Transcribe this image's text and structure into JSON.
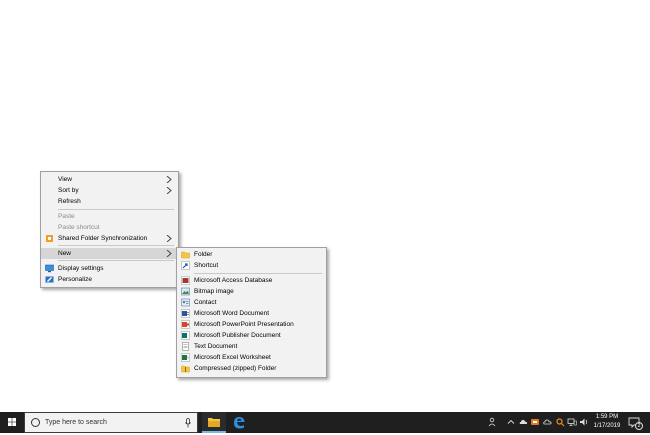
{
  "context_menu": {
    "items": [
      {
        "label": "View",
        "arrow": true,
        "disabled": false
      },
      {
        "label": "Sort by",
        "arrow": true,
        "disabled": false
      },
      {
        "label": "Refresh",
        "arrow": false,
        "disabled": false
      },
      {
        "label": "Paste",
        "arrow": false,
        "disabled": true
      },
      {
        "label": "Paste shortcut",
        "arrow": false,
        "disabled": true
      },
      {
        "label": "Shared Folder Synchronization",
        "arrow": true,
        "disabled": false,
        "icon": "sync-icon"
      },
      {
        "label": "New",
        "arrow": true,
        "disabled": false,
        "highlighted": true
      },
      {
        "label": "Display settings",
        "arrow": false,
        "disabled": false,
        "icon": "display-settings-icon"
      },
      {
        "label": "Personalize",
        "arrow": false,
        "disabled": false,
        "icon": "personalize-icon"
      }
    ]
  },
  "new_submenu": {
    "items": [
      {
        "label": "Folder",
        "icon": "folder-icon"
      },
      {
        "label": "Shortcut",
        "icon": "shortcut-icon"
      },
      {
        "label": "Microsoft Access Database",
        "icon": "access-icon"
      },
      {
        "label": "Bitmap image",
        "icon": "bitmap-icon"
      },
      {
        "label": "Contact",
        "icon": "contact-icon"
      },
      {
        "label": "Microsoft Word Document",
        "icon": "word-icon"
      },
      {
        "label": "Microsoft PowerPoint Presentation",
        "icon": "powerpoint-icon"
      },
      {
        "label": "Microsoft Publisher Document",
        "icon": "publisher-icon"
      },
      {
        "label": "Text Document",
        "icon": "text-document-icon"
      },
      {
        "label": "Microsoft Excel Worksheet",
        "icon": "excel-icon"
      },
      {
        "label": "Compressed (zipped) Folder",
        "icon": "zip-folder-icon"
      }
    ]
  },
  "taskbar": {
    "search_placeholder": "Type here to search",
    "clock_time": "1:59 PM",
    "clock_date": "1/17/2019",
    "notification_count": "2"
  }
}
